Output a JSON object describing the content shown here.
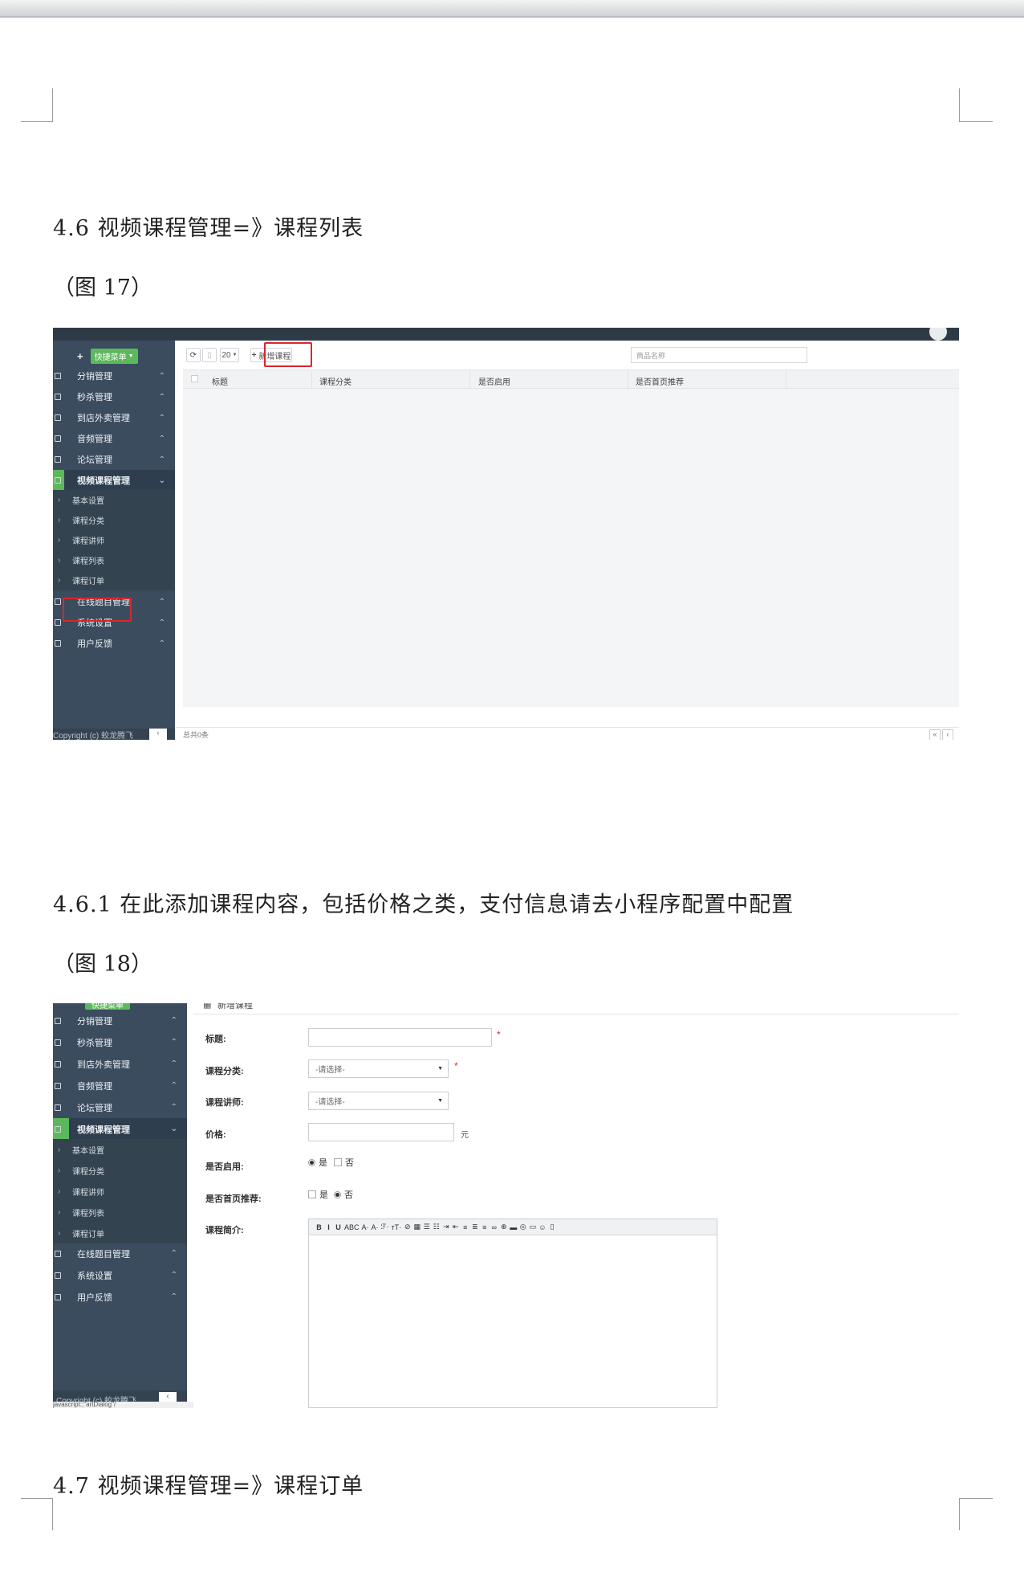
{
  "doc": {
    "h46": "4.6 视频课程管理=》课程列表",
    "cap17": "（图 17）",
    "h461": "4.6.1 在此添加课程内容，包括价格之类，支付信息请去小程序配置中配置",
    "cap18": "（图 18）",
    "h47": "4.7 视频课程管理=》课程订单"
  },
  "fig17": {
    "quick_menu": "快捷菜单",
    "nav": [
      "分销管理",
      "秒杀管理",
      "到店外卖管理",
      "音频管理",
      "论坛管理",
      "视频课程管理"
    ],
    "subnav": [
      "基本设置",
      "课程分类",
      "课程讲师",
      "课程列表",
      "课程订单"
    ],
    "nav2": [
      "在线题目管理",
      "系统设置",
      "用户反馈"
    ],
    "copyright": "Copyright (c) 蛟龙腾飞",
    "page_size": "20",
    "add_button": "新增课程",
    "search_placeholder": "商品名称",
    "columns": [
      "标题",
      "课程分类",
      "是否启用",
      "是否首页推荐"
    ],
    "total": "总共0条"
  },
  "fig18": {
    "quick_menu": "快捷菜单",
    "page_title": "新增课程",
    "nav": [
      "分销管理",
      "秒杀管理",
      "到店外卖管理",
      "音频管理",
      "论坛管理",
      "视频课程管理"
    ],
    "subnav": [
      "基本设置",
      "课程分类",
      "课程讲师",
      "课程列表",
      "课程订单"
    ],
    "nav2": [
      "在线题目管理",
      "系统设置",
      "用户反馈"
    ],
    "copyright": "Copyright (c) 蛟龙腾飞",
    "status_text": "javascript:;\"artDialog\"/",
    "labels": {
      "title": "标题:",
      "category": "课程分类:",
      "teacher": "课程讲师:",
      "price": "价格:",
      "enabled": "是否启用:",
      "home": "是否首页推荐:",
      "intro": "课程简介:"
    },
    "select_placeholder": "-请选择-",
    "price_unit": "元",
    "yes": "是",
    "no": "否",
    "toolbar": [
      "B",
      "I",
      "U",
      "ABC",
      "A·",
      "A·",
      "ℱ·",
      "тT·",
      "⊘",
      "▦",
      "☰",
      "☷",
      "⇥",
      "⇤",
      "≡",
      "≣",
      "≡",
      "∞",
      "⊕",
      "▬",
      "◎",
      "▭",
      "☺",
      "▯"
    ]
  }
}
